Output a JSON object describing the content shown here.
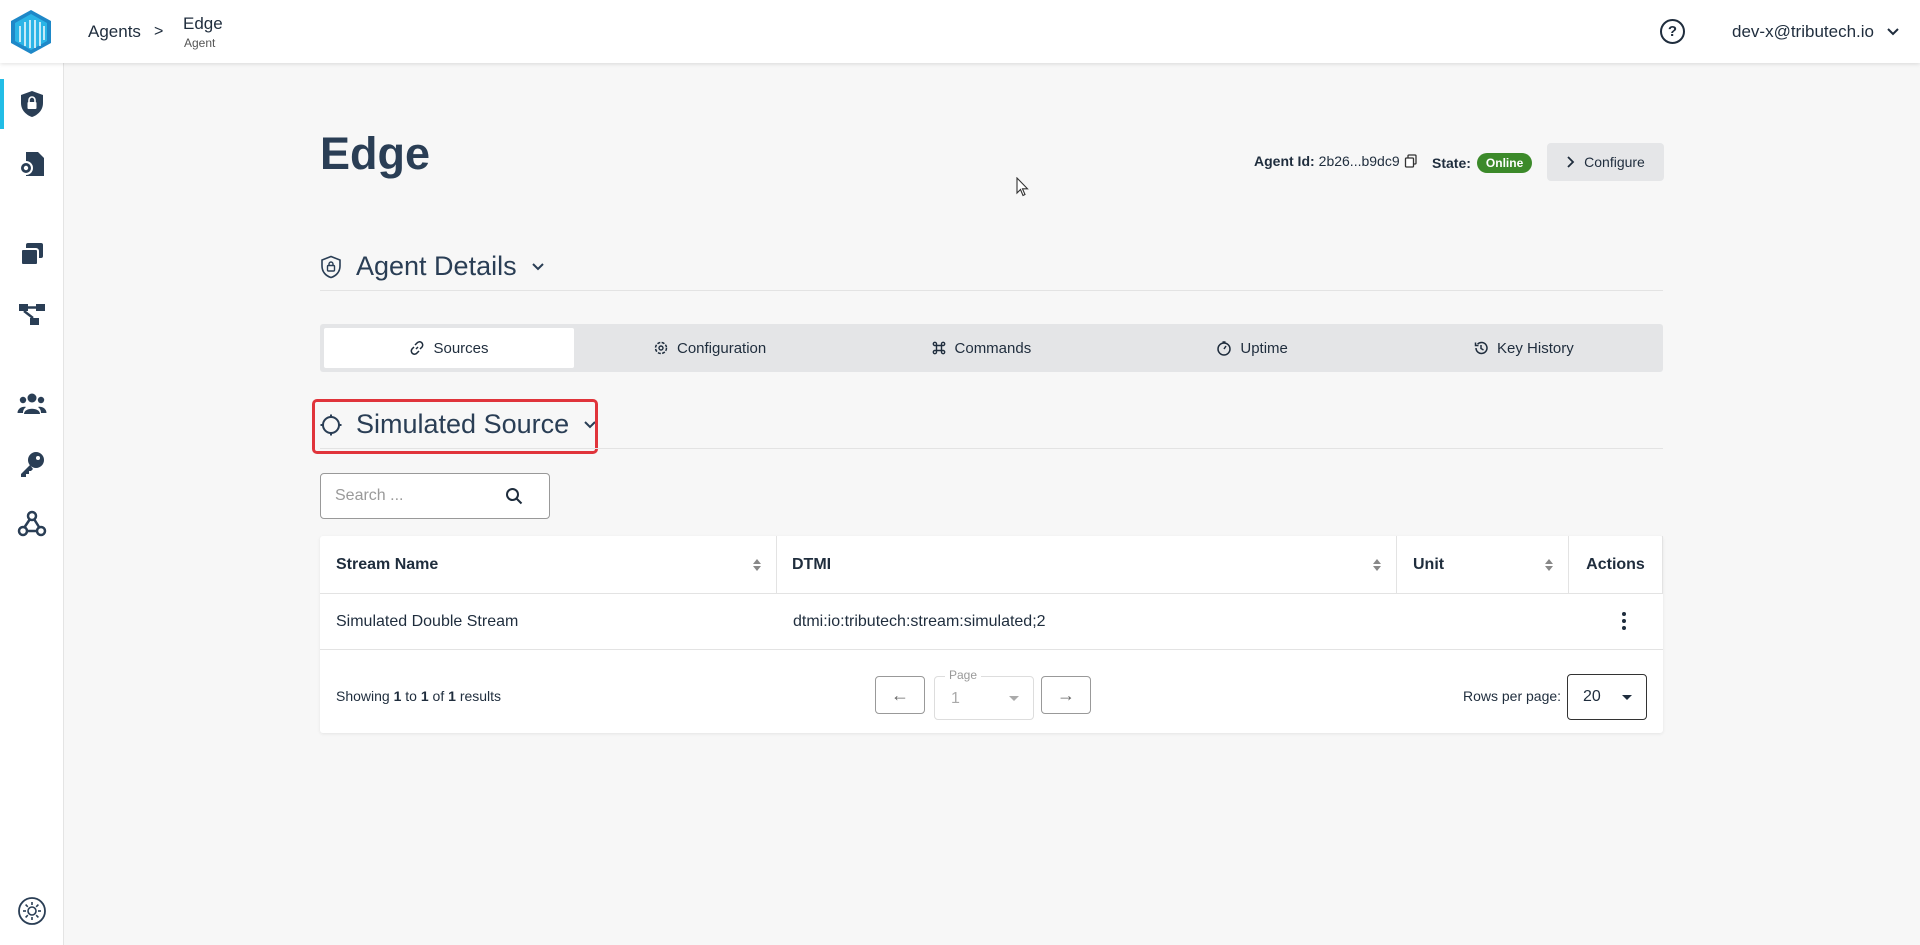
{
  "header": {
    "breadcrumb_root": "Agents",
    "breadcrumb_separator": ">",
    "breadcrumb_current": "Edge",
    "breadcrumb_current_sub": "Agent",
    "help": "?",
    "user_email": "dev-x@tributech.io"
  },
  "sidebar": {
    "items": [
      {
        "icon": "shield-lock-icon",
        "active": true
      },
      {
        "icon": "document-gear-icon"
      },
      {
        "icon": "stack-cards-icon"
      },
      {
        "icon": "network-nodes-icon"
      },
      {
        "icon": "users-icon"
      },
      {
        "icon": "key-icon"
      },
      {
        "icon": "webhook-icon"
      },
      {
        "icon": "theme-toggle-icon"
      }
    ]
  },
  "agent": {
    "title": "Edge",
    "id_label": "Agent Id:",
    "id_value": "2b26...b9dc9",
    "state_label": "State:",
    "state_value": "Online",
    "configure_label": "Configure"
  },
  "agent_details": {
    "title": "Agent Details"
  },
  "tabs": [
    {
      "label": "Sources",
      "icon": "link-icon",
      "active": true
    },
    {
      "label": "Configuration",
      "icon": "gear-icon"
    },
    {
      "label": "Commands",
      "icon": "command-icon"
    },
    {
      "label": "Uptime",
      "icon": "timer-icon"
    },
    {
      "label": "Key History",
      "icon": "history-icon"
    }
  ],
  "source": {
    "title": "Simulated Source"
  },
  "search": {
    "placeholder": "Search ..."
  },
  "table": {
    "columns": [
      "Stream Name",
      "DTMI",
      "Unit",
      "Actions"
    ],
    "rows": [
      {
        "stream_name": "Simulated Double Stream",
        "dtmi": "dtmi:io:tributech:stream:simulated;2",
        "unit": ""
      }
    ]
  },
  "pagination": {
    "showing_prefix": "Showing",
    "from": "1",
    "to_word": "to",
    "to": "1",
    "of_word": "of",
    "total": "1",
    "results_word": "results",
    "prev": "←",
    "next": "→",
    "page_label": "Page",
    "page_value": "1",
    "rows_per_page_label": "Rows per page:",
    "rows_per_page_value": "20"
  },
  "colors": {
    "accent": "#22bde6",
    "online": "#3c8a2a",
    "highlight": "#e0343b",
    "heading": "#2a3e55"
  }
}
